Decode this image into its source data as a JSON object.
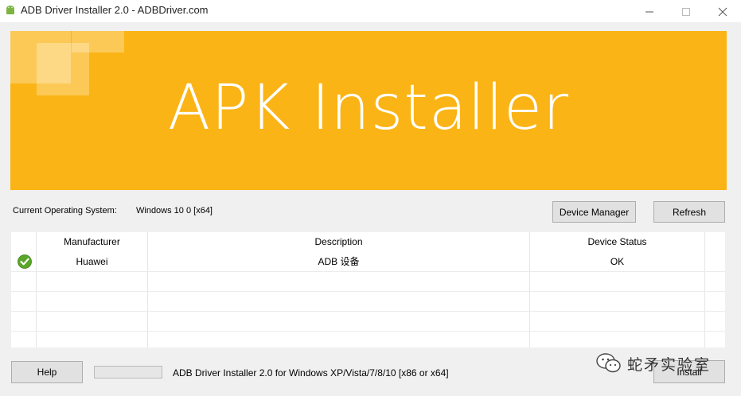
{
  "window": {
    "title": "ADB Driver Installer 2.0 - ADBDriver.com",
    "controls": [
      "minimize",
      "maximize",
      "close"
    ]
  },
  "banner": {
    "title": "APK Installer",
    "background": "#fbb415"
  },
  "system": {
    "os_label": "Current Operating System:",
    "os_value": "Windows 10 0 [x64]"
  },
  "buttons": {
    "device_manager": "Device Manager",
    "refresh": "Refresh",
    "help": "Help",
    "install": "Install"
  },
  "table": {
    "columns": [
      "Manufacturer",
      "Description",
      "Device Status"
    ],
    "rows": [
      {
        "status_icon": "check-icon",
        "manufacturer": "Huawei",
        "description": "ADB 设备",
        "status": "OK"
      }
    ]
  },
  "footer": {
    "progress": 0,
    "text": "ADB Driver Installer 2.0 for Windows XP/Vista/7/8/10 [x86 or x64]"
  },
  "watermark": {
    "icon": "wechat-icon",
    "text": "蛇矛实验室"
  }
}
